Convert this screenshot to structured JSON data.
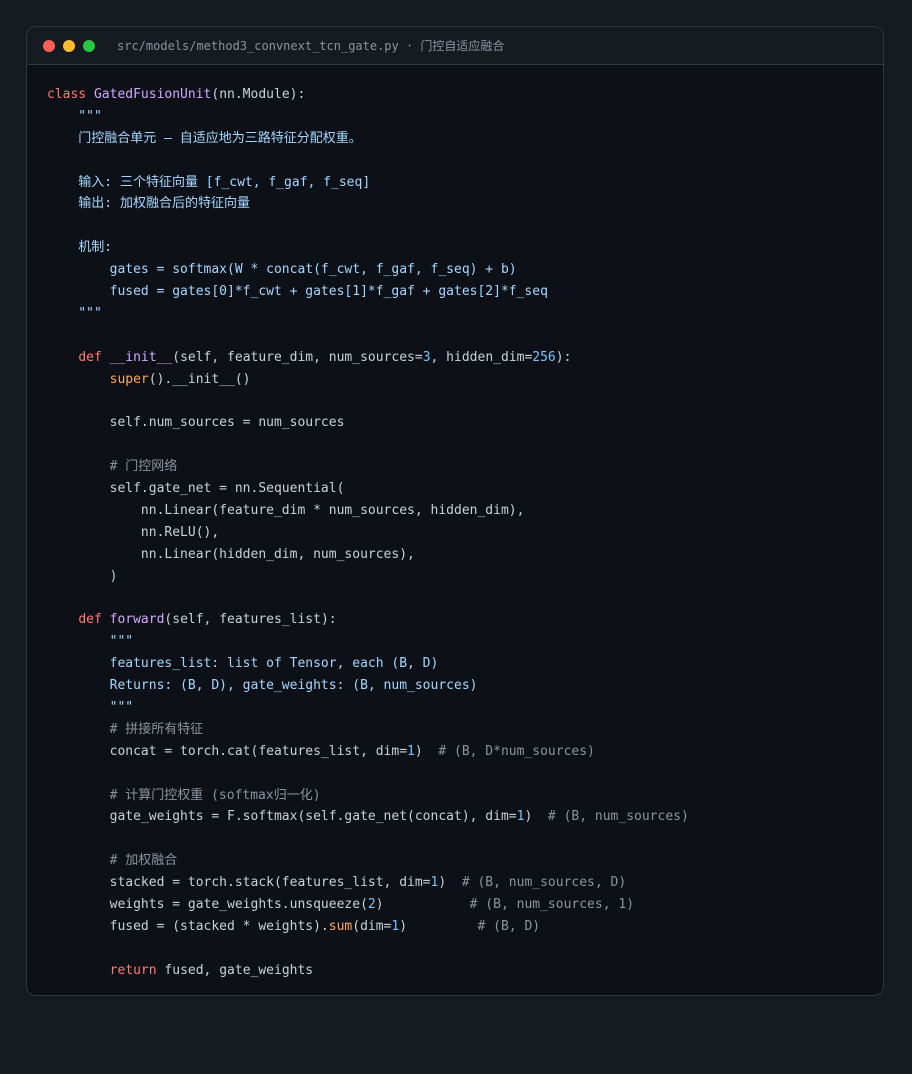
{
  "window": {
    "title": "src/models/method3_convnext_tcn_gate.py · 门控自适应融合",
    "controls": [
      "close-dot",
      "minimize-dot",
      "maximize-dot"
    ]
  },
  "colors": {
    "background": "#161b22",
    "editor_background": "#0d1117",
    "keyword": "#ff7b72",
    "class_function": "#d2a8ff",
    "string": "#a5d6ff",
    "number": "#79c0ff",
    "comment": "#8b949e",
    "builtin": "#ffa657",
    "text": "#c9d1d9"
  },
  "code_lines": [
    [
      [
        "kw",
        "class "
      ],
      [
        "cls",
        "GatedFusionUnit"
      ],
      [
        "tx",
        "(nn.Module):"
      ]
    ],
    [
      [
        "str",
        "    \"\"\""
      ]
    ],
    [
      [
        "str",
        "    门控融合单元 — 自适应地为三路特征分配权重。"
      ]
    ],
    [],
    [
      [
        "str",
        "    输入: 三个特征向量 [f_cwt, f_gaf, f_seq]"
      ]
    ],
    [
      [
        "str",
        "    输出: 加权融合后的特征向量"
      ]
    ],
    [],
    [
      [
        "str",
        "    机制:"
      ]
    ],
    [
      [
        "str",
        "        gates = softmax(W * concat(f_cwt, f_gaf, f_seq) + b)"
      ]
    ],
    [
      [
        "str",
        "        fused = gates[0]*f_cwt + gates[1]*f_gaf + gates[2]*f_seq"
      ]
    ],
    [
      [
        "str",
        "    \"\"\""
      ]
    ],
    [],
    [
      [
        "tx",
        "    "
      ],
      [
        "kw",
        "def "
      ],
      [
        "fn",
        "__init__"
      ],
      [
        "tx",
        "(self, feature_dim, num_sources="
      ],
      [
        "num",
        "3"
      ],
      [
        "tx",
        ", hidden_dim="
      ],
      [
        "num",
        "256"
      ],
      [
        "tx",
        "):"
      ]
    ],
    [
      [
        "tx",
        "        "
      ],
      [
        "bi",
        "super"
      ],
      [
        "tx",
        "().__init__()"
      ]
    ],
    [],
    [
      [
        "tx",
        "        self.num_sources = num_sources"
      ]
    ],
    [],
    [
      [
        "com",
        "        # 门控网络"
      ]
    ],
    [
      [
        "tx",
        "        self.gate_net = nn.Sequential("
      ]
    ],
    [
      [
        "tx",
        "            nn.Linear(feature_dim * num_sources, hidden_dim),"
      ]
    ],
    [
      [
        "tx",
        "            nn.ReLU(),"
      ]
    ],
    [
      [
        "tx",
        "            nn.Linear(hidden_dim, num_sources),"
      ]
    ],
    [
      [
        "tx",
        "        )"
      ]
    ],
    [],
    [
      [
        "tx",
        "    "
      ],
      [
        "kw",
        "def "
      ],
      [
        "fn",
        "forward"
      ],
      [
        "tx",
        "(self, features_list):"
      ]
    ],
    [
      [
        "str",
        "        \"\"\""
      ]
    ],
    [
      [
        "str",
        "        features_list: list of Tensor, each (B, D)"
      ]
    ],
    [
      [
        "str",
        "        Returns: (B, D), gate_weights: (B, num_sources)"
      ]
    ],
    [
      [
        "str",
        "        \"\"\""
      ]
    ],
    [
      [
        "com",
        "        # 拼接所有特征"
      ]
    ],
    [
      [
        "tx",
        "        concat = torch.cat(features_list, dim="
      ],
      [
        "num",
        "1"
      ],
      [
        "tx",
        ")  "
      ],
      [
        "com",
        "# (B, D*num_sources)"
      ]
    ],
    [],
    [
      [
        "com",
        "        # 计算门控权重 (softmax归一化)"
      ]
    ],
    [
      [
        "tx",
        "        gate_weights = F.softmax(self.gate_net(concat), dim="
      ],
      [
        "num",
        "1"
      ],
      [
        "tx",
        ")  "
      ],
      [
        "com",
        "# (B, num_sources)"
      ]
    ],
    [],
    [
      [
        "com",
        "        # 加权融合"
      ]
    ],
    [
      [
        "tx",
        "        stacked = torch.stack(features_list, dim="
      ],
      [
        "num",
        "1"
      ],
      [
        "tx",
        ")  "
      ],
      [
        "com",
        "# (B, num_sources, D)"
      ]
    ],
    [
      [
        "tx",
        "        weights = gate_weights.unsqueeze("
      ],
      [
        "num",
        "2"
      ],
      [
        "tx",
        ")           "
      ],
      [
        "com",
        "# (B, num_sources, 1)"
      ]
    ],
    [
      [
        "tx",
        "        fused = (stacked * weights)."
      ],
      [
        "bi",
        "sum"
      ],
      [
        "tx",
        "(dim="
      ],
      [
        "num",
        "1"
      ],
      [
        "tx",
        ")         "
      ],
      [
        "com",
        "# (B, D)"
      ]
    ],
    [],
    [
      [
        "tx",
        "        "
      ],
      [
        "kw",
        "return "
      ],
      [
        "tx",
        "fused, gate_weights"
      ]
    ]
  ]
}
